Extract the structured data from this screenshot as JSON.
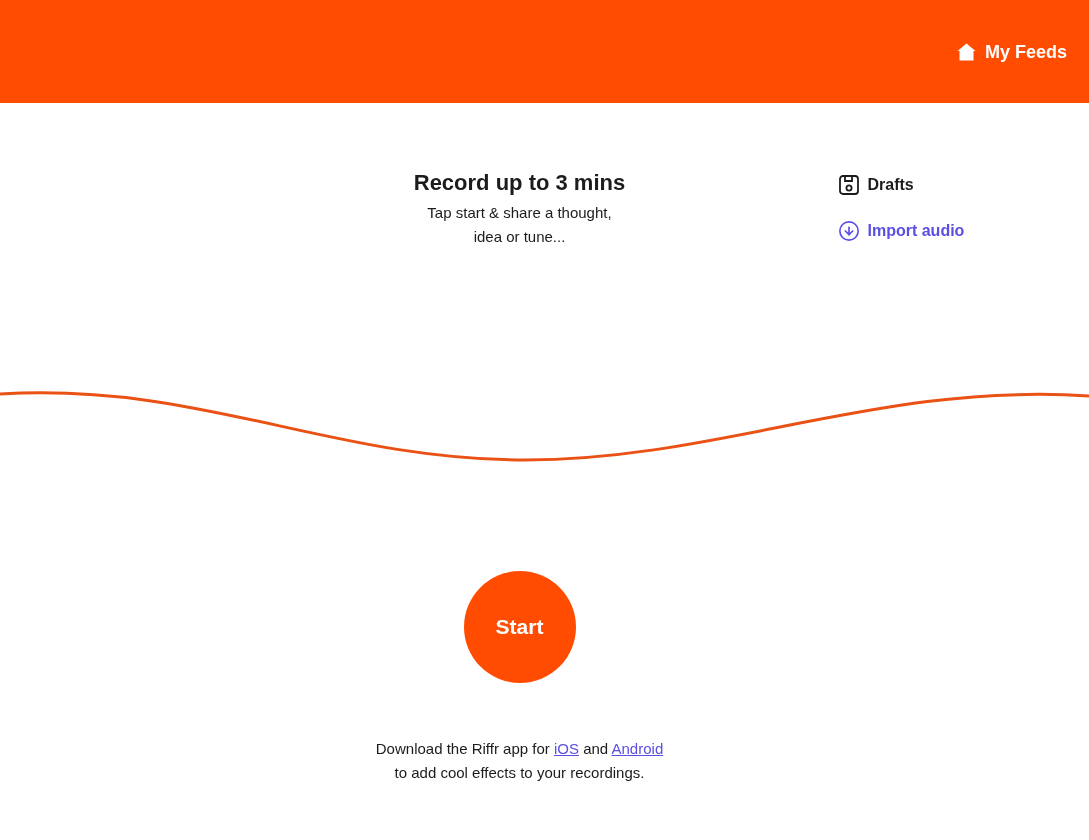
{
  "header": {
    "nav_link": {
      "label": "My Feeds"
    }
  },
  "recorder": {
    "title": "Record up to 3 mins",
    "subtitle": "Tap start & share a thought, idea or tune..."
  },
  "side_links": [
    {
      "kind": "drafts",
      "label": "Drafts"
    },
    {
      "kind": "import",
      "label": "Import audio"
    }
  ],
  "start_button": {
    "label": "Start"
  },
  "footer": {
    "parts": [
      {
        "kind": "text",
        "text": "Download the Riffr app for"
      },
      {
        "kind": "link",
        "text": "iOS"
      },
      {
        "kind": "text",
        "text": "and"
      },
      {
        "kind": "link",
        "text": "Android"
      },
      {
        "kind": "text",
        "text": "to add cool effects to your recordings."
      }
    ]
  }
}
